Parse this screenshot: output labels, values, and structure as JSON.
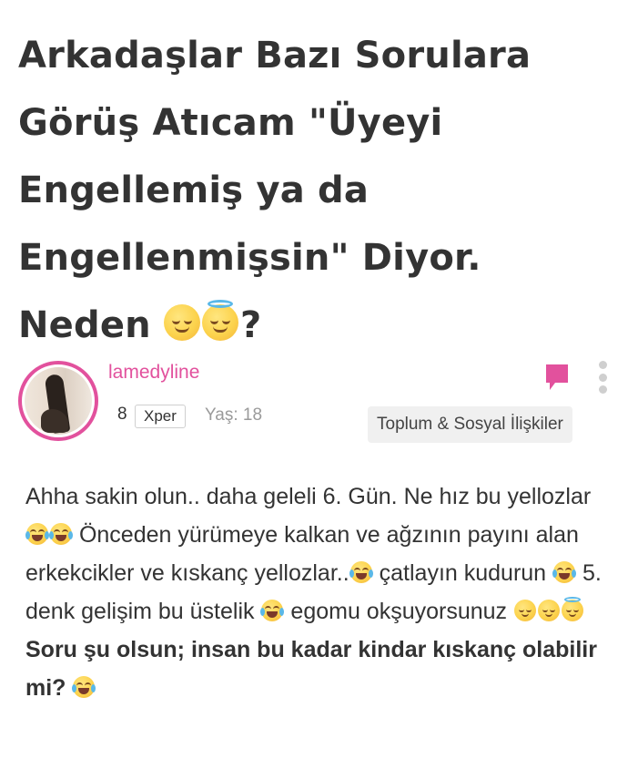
{
  "question": {
    "title_text": "Arkadaşlar Bazı Sorulara Görüş Atıcam \"Üyeyi Engellemiş ya da Engellenmişsin\" Diyor. Neden",
    "title_end": "?",
    "title_emojis": [
      "relieved-face",
      "smiling-face-with-halo"
    ]
  },
  "author": {
    "username": "lamedyline",
    "level": "8",
    "badge": "Xper",
    "age": "Yaş: 18"
  },
  "category": "Toplum & Sosyal İlişkiler",
  "body": {
    "line1": "Ahha sakin olun.. daha geleli 6. Gün. Ne hız bu yellozlar",
    "line2": "Önceden yürümeye kalkan ve ağzının payını alan erkekcikler ve kıskanç yellozlar..",
    "line3": "çatlayın kudurun",
    "line4": "5. denk gelişim bu üstelik",
    "line5": "egomu okşuyorsunuz",
    "bold": "Soru şu olsun; insan bu kadar kindar kıskanç olabilir mi?"
  },
  "colors": {
    "accent": "#e2519d",
    "text": "#333333",
    "muted": "#9a9a9a",
    "category_bg": "#f0f0f0"
  }
}
